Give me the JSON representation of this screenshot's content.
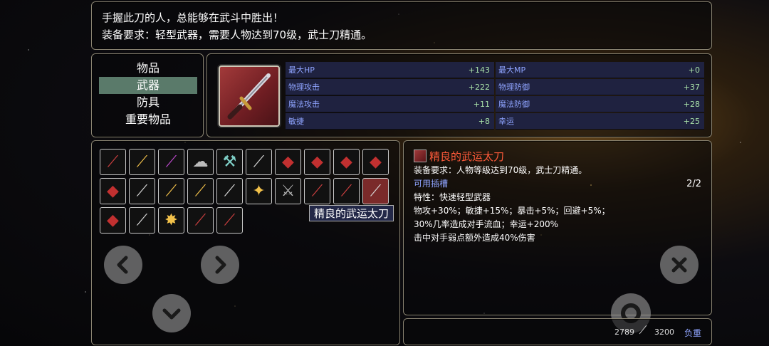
{
  "description": {
    "line1": "手握此刀的人，总能够在武斗中胜出！",
    "line2": "装备要求：轻型武器，需要人物达到70级，武士刀精通。"
  },
  "categories": [
    {
      "label": "物品",
      "selected": false
    },
    {
      "label": "武器",
      "selected": true
    },
    {
      "label": "防具",
      "selected": false
    },
    {
      "label": "重要物品",
      "selected": false
    }
  ],
  "stats": [
    {
      "label": "最大HP",
      "value": "+143"
    },
    {
      "label": "最大MP",
      "value": "+0"
    },
    {
      "label": "物理攻击",
      "value": "+222"
    },
    {
      "label": "物理防御",
      "value": "+37"
    },
    {
      "label": "魔法攻击",
      "value": "+11"
    },
    {
      "label": "魔法防御",
      "value": "+28"
    },
    {
      "label": "敏捷",
      "value": "+8"
    },
    {
      "label": "幸运",
      "value": "+25"
    }
  ],
  "inventory_icons": [
    "katana-icon",
    "torch-staff-icon",
    "purple-staff-icon",
    "smoke-icon",
    "axe-icon",
    "dagger-icon",
    "armor-box-icon",
    "armor-box-icon",
    "armor-box-icon",
    "armor-box-icon",
    "armor-box-icon",
    "spear-icon",
    "golden-sword-icon",
    "golden-sword-icon",
    "dagger-icon",
    "mace-icon",
    "battle-axe-icon",
    "red-blade-icon",
    "red-blade-icon",
    "katana-icon",
    "armor-box-icon",
    "light-blade-icon",
    "golden-burst-icon",
    "red-blade-icon",
    "red-blade-icon"
  ],
  "tooltip": "精良的武运太刀",
  "detail": {
    "name": "精良的武运太刀",
    "requirement": "装备要求：人物等级达到70级，武士刀精通。",
    "slots_label": "可用插槽",
    "slots_count": "2/2",
    "trait": "特性：快速轻型武器",
    "bonus1": "物攻+30%；敏捷+15%；暴击+5%；回避+5%；",
    "bonus2": "30%几率造成对手流血；幸运+200%",
    "bonus3": "击中对手弱点额外造成40%伤害"
  },
  "weight": {
    "current": "2789",
    "max": "3200",
    "label": "负重"
  },
  "colors": {
    "selected_category": "#5a7a6a",
    "stat_row_bg": "#1f2240",
    "stat_label": "#8fa4ff",
    "stat_value": "#a8e0a8",
    "item_name": "#ff5a3a"
  }
}
